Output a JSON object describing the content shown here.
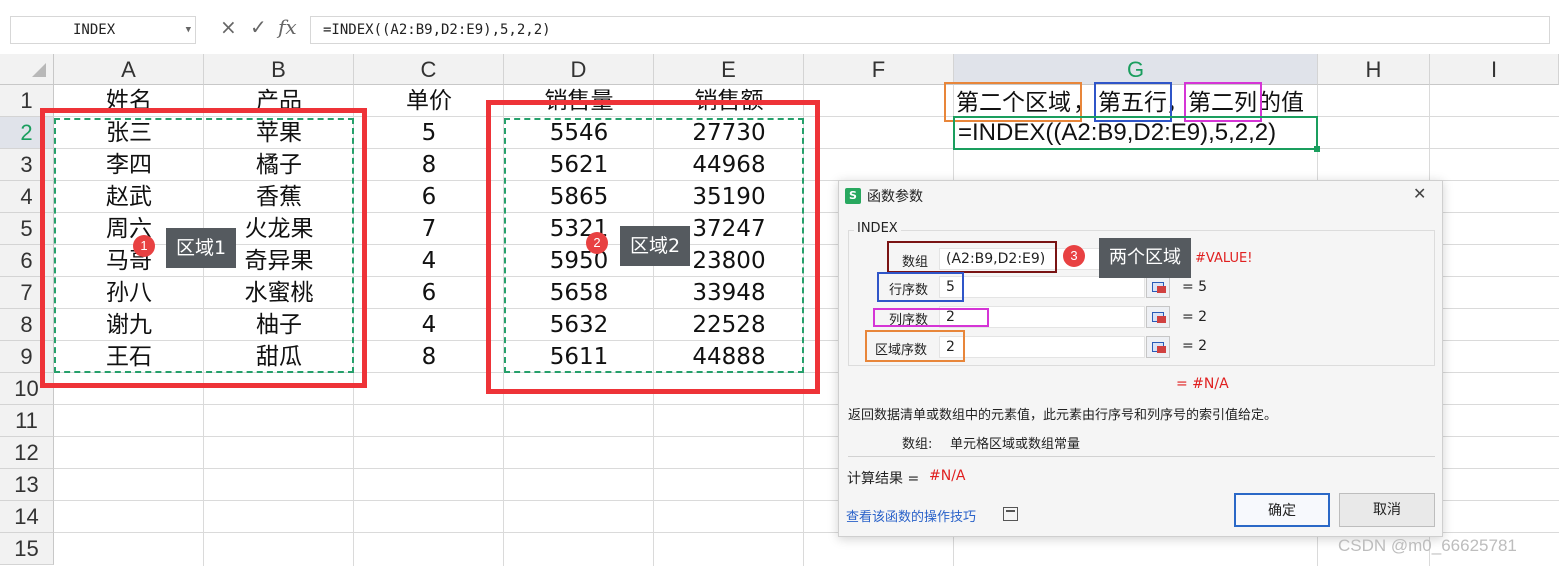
{
  "formula_bar": {
    "name_box": "INDEX",
    "cancel_glyph": "×",
    "confirm_glyph": "✓",
    "fx_label": "fx",
    "formula": "=INDEX((A2:B9,D2:E9),5,2,2)"
  },
  "columns": [
    "A",
    "B",
    "C",
    "D",
    "E",
    "F",
    "G",
    "H",
    "I"
  ],
  "selected_column": "G",
  "rows": [
    "1",
    "2",
    "3",
    "4",
    "5",
    "6",
    "7",
    "8",
    "9",
    "10",
    "11",
    "12",
    "13",
    "14",
    "15"
  ],
  "selected_row": "2",
  "table": {
    "headers": [
      "姓名",
      "产品",
      "单价",
      "销售量",
      "销售额"
    ],
    "rows": [
      [
        "张三",
        "苹果",
        "5",
        "5546",
        "27730"
      ],
      [
        "李四",
        "橘子",
        "8",
        "5621",
        "44968"
      ],
      [
        "赵武",
        "香蕉",
        "6",
        "5865",
        "35190"
      ],
      [
        "周六",
        "火龙果",
        "7",
        "5321",
        "37247"
      ],
      [
        "马哥",
        "奇异果",
        "4",
        "5950",
        "23800"
      ],
      [
        "孙八",
        "水蜜桃",
        "6",
        "5658",
        "33948"
      ],
      [
        "谢九",
        "柚子",
        "4",
        "5632",
        "22528"
      ],
      [
        "王石",
        "甜瓜",
        "8",
        "5611",
        "44888"
      ]
    ]
  },
  "annotations": {
    "region1": {
      "badge": "1",
      "label": "区域1"
    },
    "region2": {
      "badge": "2",
      "label": "区域2"
    },
    "dialog_note": {
      "badge": "3",
      "label": "两个区域"
    },
    "g1_parts": [
      "第二个区域",
      "，",
      "第五行",
      "，",
      "第二列",
      "的值"
    ],
    "g2_formula": "=INDEX((A2:B9,D2:E9),5,2,2)"
  },
  "dialog": {
    "title": "函数参数",
    "function_name": "INDEX",
    "args": [
      {
        "label": "数组",
        "value": "(A2:B9,D2:E9)",
        "result": "= #VALUE!"
      },
      {
        "label": "行序数",
        "value": "5",
        "result": "= 5"
      },
      {
        "label": "列序数",
        "value": "2",
        "result": "= 2"
      },
      {
        "label": "区域序数",
        "value": "2",
        "result": "= 2"
      }
    ],
    "overall_result": "= #N/A",
    "description": "返回数据清单或数组中的元素值，此元素由行序号和列序号的索引值给定。",
    "param_help_label": "数组:",
    "param_help_text": "单元格区域或数组常量",
    "calc_result_label": "计算结果 =",
    "calc_result_value": "#N/A",
    "tips_link": "查看该函数的操作技巧",
    "ok_label": "确定",
    "cancel_label": "取消",
    "close_glyph": "✕",
    "app_icon_letter": "S"
  },
  "watermark": "CSDN @m0_66625781",
  "colors": {
    "region_box": "#ee3338",
    "dashed_selection": "#26a06b",
    "orange_box": "#e8863a",
    "blue_box": "#2f55c8",
    "magenta_box": "#d535d6",
    "maroon_box": "#7a1414",
    "error_red": "#e02020"
  }
}
